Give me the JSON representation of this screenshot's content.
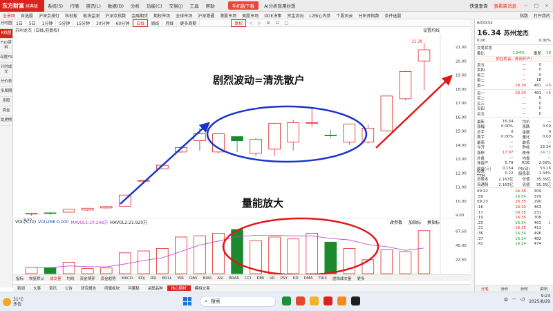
{
  "app": {
    "logo": "东方财富",
    "logo_sub": "经典版"
  },
  "menu": [
    "系统(S)",
    "行情",
    "资讯(L)",
    "数据(D)",
    "分析",
    "功能(C)",
    "交易(J)",
    "工具",
    "帮助"
  ],
  "promo": "手机版下载",
  "promo2": "AI分析就用妙想",
  "titlebar_right": {
    "quick": "快速查询",
    "msg": "查看新消息",
    "min": "—",
    "max": "□",
    "close": "×"
  },
  "tabs": [
    "全景图",
    "自选股",
    "沪深京排行",
    "科创板",
    "板块监测",
    "沪深京指数",
    "金融期货",
    "期权市场",
    "全球市场",
    "沪深港通",
    "港股市场",
    "美股市场",
    "DDE决策",
    "资金流向",
    "L2核心内参",
    "个股风云",
    "分析师指数",
    "条件选股"
  ],
  "tabs_right": [
    "指数",
    "打开我的"
  ],
  "leftnav": [
    "分时图",
    "K线图",
    "F10资料",
    "深度F9",
    "分时成交",
    "分价表",
    "多周期",
    "多股",
    "资金",
    "龙虎榜"
  ],
  "periods": [
    "1日",
    "5日",
    "1分钟",
    "5分钟",
    "15分钟",
    "30分钟",
    "60分钟",
    "日线",
    "周线",
    "月线",
    "更多周期"
  ],
  "period_selected": "复权",
  "period_ctl": [
    "◁",
    "▷",
    "⊞",
    "⊟",
    "□"
  ],
  "info": {
    "name": "苏州龙杰",
    "mode": "(日线,前复权)",
    "setting": "设置均线"
  },
  "chart_data": {
    "type": "candlestick",
    "ylim": [
      9.0,
      21.0
    ],
    "yticks": [
      "21.00",
      "20.00",
      "19.00",
      "18.00",
      "17.00",
      "16.00",
      "15.00",
      "14.00",
      "13.00",
      "12.00",
      "11.00",
      "10.00",
      "9.00"
    ],
    "candles": [
      {
        "o": 9.06,
        "h": 9.15,
        "l": 8.95,
        "c": 9.12,
        "v": 10
      },
      {
        "o": 9.1,
        "h": 9.2,
        "l": 9.0,
        "c": 9.15,
        "v": 9
      },
      {
        "o": 9.2,
        "h": 9.42,
        "l": 9.18,
        "c": 9.4,
        "v": 18
      },
      {
        "o": 9.35,
        "h": 9.5,
        "l": 9.3,
        "c": 9.48,
        "v": 8
      },
      {
        "o": 9.5,
        "h": 9.65,
        "l": 9.45,
        "c": 9.6,
        "v": 9
      },
      {
        "o": 9.62,
        "h": 10.45,
        "l": 9.6,
        "c": 10.42,
        "v": 33
      },
      {
        "o": 11.42,
        "h": 11.5,
        "l": 11.35,
        "c": 11.46,
        "v": 36
      },
      {
        "o": 12.3,
        "h": 12.6,
        "l": 12.25,
        "c": 12.55,
        "v": 40
      },
      {
        "o": 13.5,
        "h": 13.9,
        "l": 13.45,
        "c": 13.82,
        "v": 58
      },
      {
        "o": 14.3,
        "h": 15.2,
        "l": 13.6,
        "c": 14.8,
        "v": 60
      },
      {
        "o": 13.5,
        "h": 14.85,
        "l": 13.4,
        "c": 14.8,
        "v": 64
      },
      {
        "o": 14.3,
        "h": 14.45,
        "l": 13.5,
        "c": 14.6,
        "v": 70
      },
      {
        "o": 14.4,
        "h": 14.5,
        "l": 13.2,
        "c": 13.4,
        "v": 52
      },
      {
        "o": 13.7,
        "h": 15.6,
        "l": 13.2,
        "c": 15.55,
        "v": 58
      },
      {
        "o": 14.2,
        "h": 15.8,
        "l": 13.6,
        "c": 15.6,
        "v": 55
      },
      {
        "o": 15.6,
        "h": 16.6,
        "l": 15.3,
        "c": 15.6,
        "v": 64
      },
      {
        "o": 14.7,
        "h": 15.1,
        "l": 14.5,
        "c": 14.7,
        "v": 50
      },
      {
        "o": 14.2,
        "h": 15.5,
        "l": 14.0,
        "c": 15.5,
        "v": 40
      },
      {
        "o": 15.2,
        "h": 15.45,
        "l": 14.1,
        "c": 14.2,
        "v": 22
      },
      {
        "o": 15.0,
        "h": 17.5,
        "l": 14.95,
        "c": 17.5,
        "v": 38
      },
      {
        "o": 17.3,
        "h": 19.3,
        "l": 17.2,
        "c": 19.25,
        "v": 35
      },
      {
        "o": 20.0,
        "h": 21.28,
        "l": 17.9,
        "c": 20.8,
        "v": 68
      }
    ],
    "bear": [
      false,
      true,
      false,
      false,
      false,
      false,
      false,
      false,
      false,
      false,
      false,
      true,
      false,
      false,
      false,
      false,
      true,
      false,
      false,
      false,
      false,
      false
    ],
    "vol_max": 70,
    "vol_ticks": [
      "67.50",
      "45.00",
      "22.50"
    ],
    "vol_label": "VOL(5,10)",
    "vol_volume": "VOLUME:0,000",
    "vol_ma1": "MAVOL1:20.248万",
    "vol_ma2": "MAVOL2:21.920万",
    "low_label": "8.82",
    "high_label": "21.28",
    "xlabel_start": "05"
  },
  "annotations": {
    "a1": "剧烈波动=清洗散户",
    "a2": "量能放大"
  },
  "vol_right": [
    "改参数",
    "加指标",
    "换指标"
  ],
  "indtabs": [
    "指标",
    "恢复默认",
    "成交量",
    "均线",
    "资金博弈",
    "资金趋势",
    "MACD",
    "KDJ",
    "RSI",
    "BOLL",
    "WR",
    "OBV",
    "BIAS",
    "ASI",
    "BRAR",
    "CCI",
    "DMI",
    "VR",
    "PSY",
    "KD",
    "DMA",
    "TRIX",
    "虚拟成交量",
    "更多"
  ],
  "indtab_selected": "成交量",
  "bottomtabs": [
    "新闻",
    "大事",
    "资讯",
    "公告",
    "研究报告",
    "所属板块",
    "问董秘",
    "关联品种",
    "核心题材",
    "模拟交易"
  ],
  "bottomtab_selected": "核心题材",
  "quote": {
    "code": "603332",
    "name": "苏州龙杰",
    "price": "16.34",
    "chg": "0.00",
    "pct": "0.00%",
    "status": "交易状态",
    "wb_label": "委比",
    "wb": "-1.84%",
    "wc_label": "委差",
    "wc": "-18",
    "alert": "抓住机会，即刻开户!",
    "sells": [
      {
        "l": "卖五",
        "p": "—",
        "v": "0"
      },
      {
        "l": "卖四",
        "p": "—",
        "v": "0"
      },
      {
        "l": "卖三",
        "p": "—",
        "v": "0"
      },
      {
        "l": "卖二",
        "p": "—",
        "v": "18"
      },
      {
        "l": "卖一",
        "p": "16.34",
        "v": "481",
        "d": "+5"
      }
    ],
    "buys": [
      {
        "l": "买一",
        "p": "16.34",
        "v": "481",
        "d": "+5"
      },
      {
        "l": "买二",
        "p": "—",
        "v": "0"
      },
      {
        "l": "买三",
        "p": "—",
        "v": "0"
      },
      {
        "l": "买四",
        "p": "—",
        "v": "0"
      },
      {
        "l": "买五",
        "p": "—",
        "v": "0"
      }
    ],
    "stats": [
      [
        "最新",
        "16.34",
        "均价",
        "—"
      ],
      [
        "涨幅",
        "0.00%",
        "涨跌",
        "0.00"
      ],
      [
        "总手",
        "0",
        "金额",
        "0"
      ],
      [
        "换手",
        "0.00%",
        "量比",
        "0.00"
      ],
      [
        "最高",
        "—",
        "最低",
        "—"
      ],
      [
        "今开",
        "—",
        "昨收",
        "16.34"
      ],
      [
        "涨停",
        "17.97",
        "跌停",
        "14.71"
      ],
      [
        "外盘",
        "—",
        "内盘",
        "—"
      ],
      [
        "净资产",
        "5.79",
        "ROE",
        "2.59%"
      ],
      [
        "收益(三)",
        "0.154",
        "PE(动)",
        "53.16"
      ],
      [
        "股息TTM",
        "0.22",
        "股息率",
        "1.34%"
      ],
      [
        "总股本",
        "2.163亿",
        "总值",
        "35.35亿"
      ],
      [
        "流通股",
        "2.163亿",
        "流值",
        "35.35亿"
      ]
    ],
    "ticks": [
      [
        "09:22",
        "16.35",
        "309",
        ""
      ],
      [
        ":59",
        "16.34",
        "379",
        ""
      ],
      [
        "09:23",
        "16.35",
        "290",
        ""
      ],
      [
        ":16",
        "16.35",
        "463",
        ""
      ],
      [
        ":17",
        "16.35",
        "231",
        ""
      ],
      [
        ":19",
        "16.35",
        "308",
        ""
      ],
      [
        ":20",
        "16.34",
        "463",
        "↓"
      ],
      [
        ":31",
        "16.35",
        "413",
        ""
      ],
      [
        ":36",
        "16.34",
        "496",
        ""
      ],
      [
        ":37",
        "16.34",
        "482",
        ""
      ],
      [
        ":41",
        "16.34",
        "474",
        ""
      ]
    ],
    "foot": [
      "分笔",
      "分价",
      "分时",
      "资讯"
    ],
    "foot_selected": "分笔"
  },
  "taskbar": {
    "temp": "31°C",
    "weather": "多云",
    "search": "搜索",
    "lang": "中",
    "time": "9:23",
    "date": "2025/8/29"
  }
}
